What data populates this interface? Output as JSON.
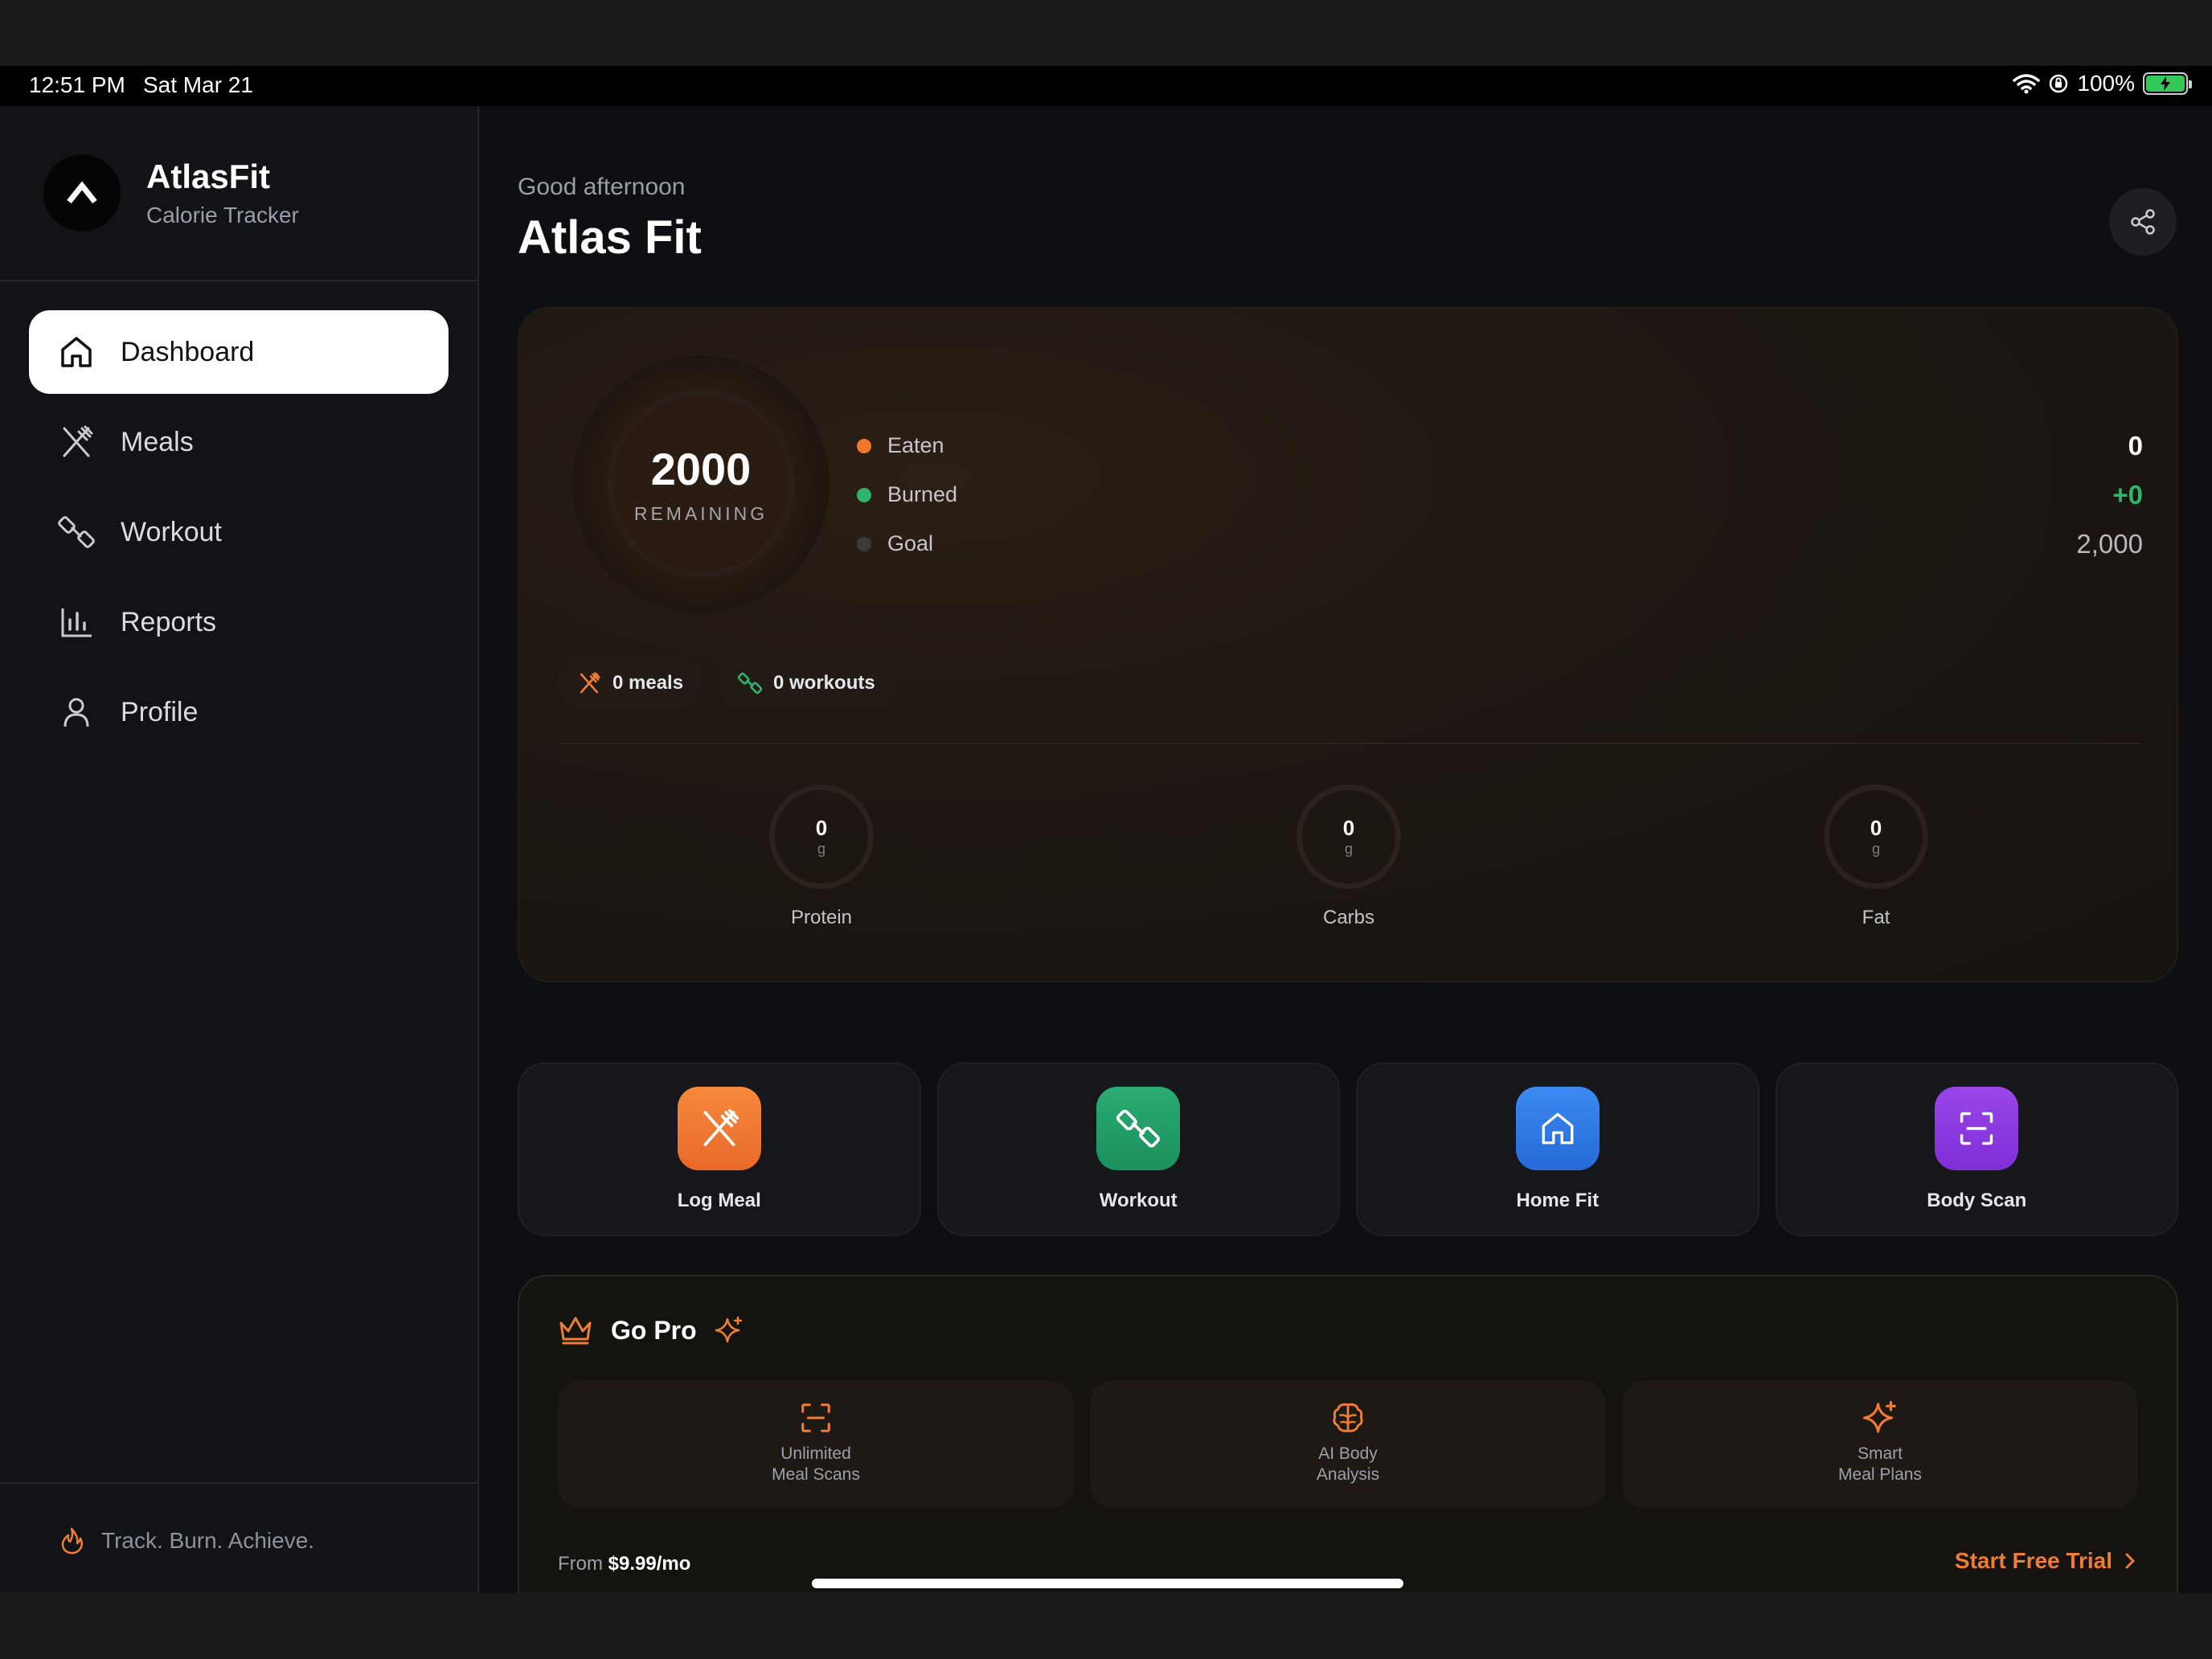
{
  "status_bar": {
    "time": "12:51 PM",
    "date": "Sat Mar 21",
    "battery": "100%"
  },
  "brand": {
    "name": "AtlasFit",
    "subtitle": "Calorie Tracker",
    "logo_icon": "chevron-up-icon"
  },
  "sidebar": {
    "items": [
      {
        "label": "Dashboard",
        "icon": "home-icon",
        "active": true
      },
      {
        "label": "Meals",
        "icon": "utensils-icon",
        "active": false
      },
      {
        "label": "Workout",
        "icon": "dumbbell-icon",
        "active": false
      },
      {
        "label": "Reports",
        "icon": "bar-chart-icon",
        "active": false
      },
      {
        "label": "Profile",
        "icon": "user-icon",
        "active": false
      }
    ],
    "tagline": "Track. Burn. Achieve."
  },
  "header": {
    "greeting": "Good afternoon",
    "title": "Atlas Fit"
  },
  "summary": {
    "remaining_value": "2000",
    "remaining_label": "REMAINING",
    "legend": [
      {
        "name": "Eaten",
        "value": "0",
        "color": "#f0782f"
      },
      {
        "name": "Burned",
        "value": "+0",
        "color": "#2fb36d"
      },
      {
        "name": "Goal",
        "value": "2,000",
        "color": "#3a3a3a"
      }
    ],
    "chips": {
      "meals": "0 meals",
      "workouts": "0 workouts"
    },
    "macros": [
      {
        "label": "Protein",
        "value": "0",
        "unit": "g"
      },
      {
        "label": "Carbs",
        "value": "0",
        "unit": "g"
      },
      {
        "label": "Fat",
        "value": "0",
        "unit": "g"
      }
    ]
  },
  "actions": [
    {
      "label": "Log Meal",
      "icon": "utensils-icon",
      "color": "#f0782f"
    },
    {
      "label": "Workout",
      "icon": "dumbbell-icon",
      "color": "#1f9e6a"
    },
    {
      "label": "Home Fit",
      "icon": "home-icon",
      "color": "#2f7be8"
    },
    {
      "label": "Body Scan",
      "icon": "scan-icon",
      "color": "#8f3ae0"
    }
  ],
  "pro": {
    "title": "Go Pro",
    "features": [
      {
        "line1": "Unlimited",
        "line2": "Meal Scans",
        "icon": "scan-icon"
      },
      {
        "line1": "AI Body",
        "line2": "Analysis",
        "icon": "brain-icon"
      },
      {
        "line1": "Smart",
        "line2": "Meal Plans",
        "icon": "sparkles-icon"
      }
    ],
    "price_prefix": "From",
    "price": "$9.99/mo",
    "cta": "Start Free Trial"
  },
  "colors": {
    "accent": "#f07d34",
    "green": "#2fb36d",
    "background": "#0d0f12"
  }
}
